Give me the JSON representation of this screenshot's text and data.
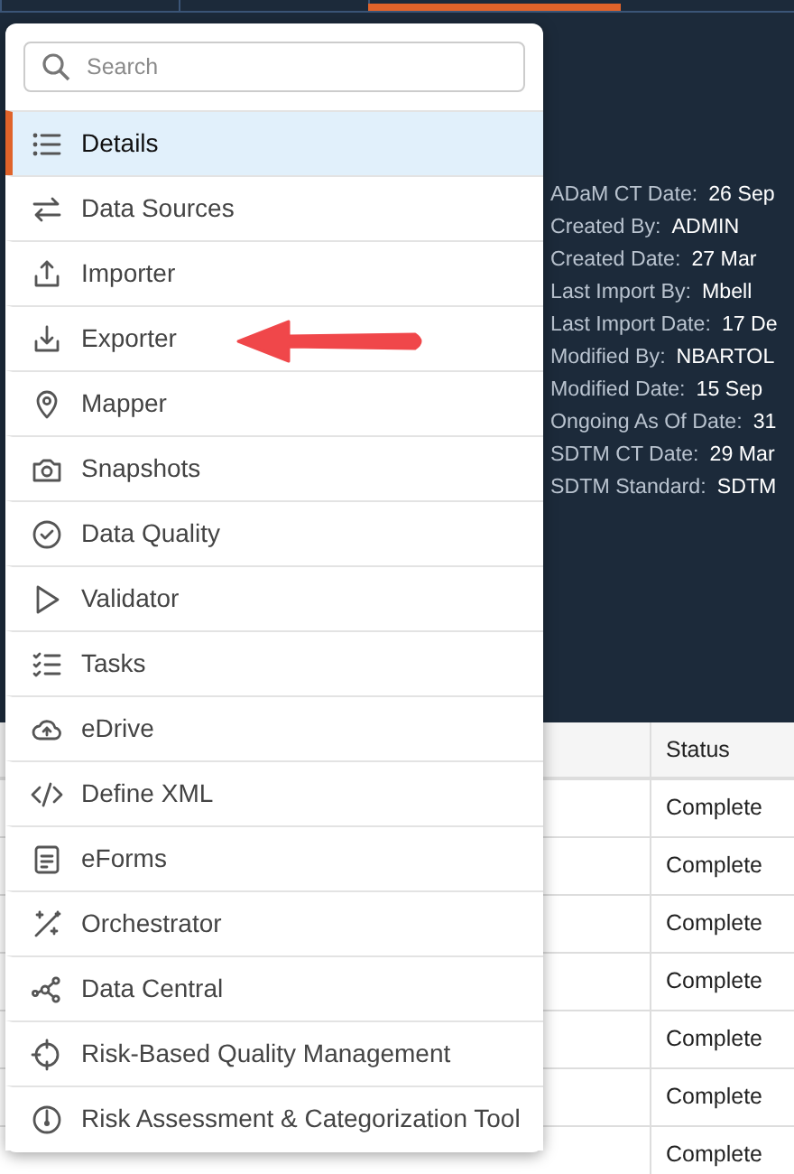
{
  "details": [
    {
      "label": "ADaM CT Date:",
      "value": "26 Sep"
    },
    {
      "label": "Created By:",
      "value": "ADMIN"
    },
    {
      "label": "Created Date:",
      "value": "27 Mar"
    },
    {
      "label": "Last Import By:",
      "value": "Mbell"
    },
    {
      "label": "Last Import Date:",
      "value": "17 De"
    },
    {
      "label": "Modified By:",
      "value": "NBARTOL"
    },
    {
      "label": "Modified Date:",
      "value": "15 Sep"
    },
    {
      "label": "Ongoing As Of Date:",
      "value": "31"
    },
    {
      "label": "SDTM CT Date:",
      "value": "29 Mar"
    },
    {
      "label": "SDTM Standard:",
      "value": "SDTM"
    }
  ],
  "table": {
    "columns": [
      "Status"
    ],
    "rows": [
      {
        "status": "Complete"
      },
      {
        "status": "Complete"
      },
      {
        "status": "Complete"
      },
      {
        "status": "Complete"
      },
      {
        "status": "Complete"
      },
      {
        "status": "Complete"
      },
      {
        "status": "Complete"
      }
    ]
  },
  "menu": {
    "search": {
      "placeholder": "Search"
    },
    "items": [
      {
        "label": "Details",
        "selected": true
      },
      {
        "label": "Data Sources",
        "selected": false
      },
      {
        "label": "Importer",
        "selected": false
      },
      {
        "label": "Exporter",
        "selected": false
      },
      {
        "label": "Mapper",
        "selected": false
      },
      {
        "label": "Snapshots",
        "selected": false
      },
      {
        "label": "Data Quality",
        "selected": false
      },
      {
        "label": "Validator",
        "selected": false
      },
      {
        "label": "Tasks",
        "selected": false
      },
      {
        "label": "eDrive",
        "selected": false
      },
      {
        "label": "Define XML",
        "selected": false
      },
      {
        "label": "eForms",
        "selected": false
      },
      {
        "label": "Orchestrator",
        "selected": false
      },
      {
        "label": "Data Central",
        "selected": false
      },
      {
        "label": "Risk-Based Quality Management",
        "selected": false
      },
      {
        "label": "Risk Assessment & Categorization Tool",
        "selected": false
      }
    ]
  }
}
